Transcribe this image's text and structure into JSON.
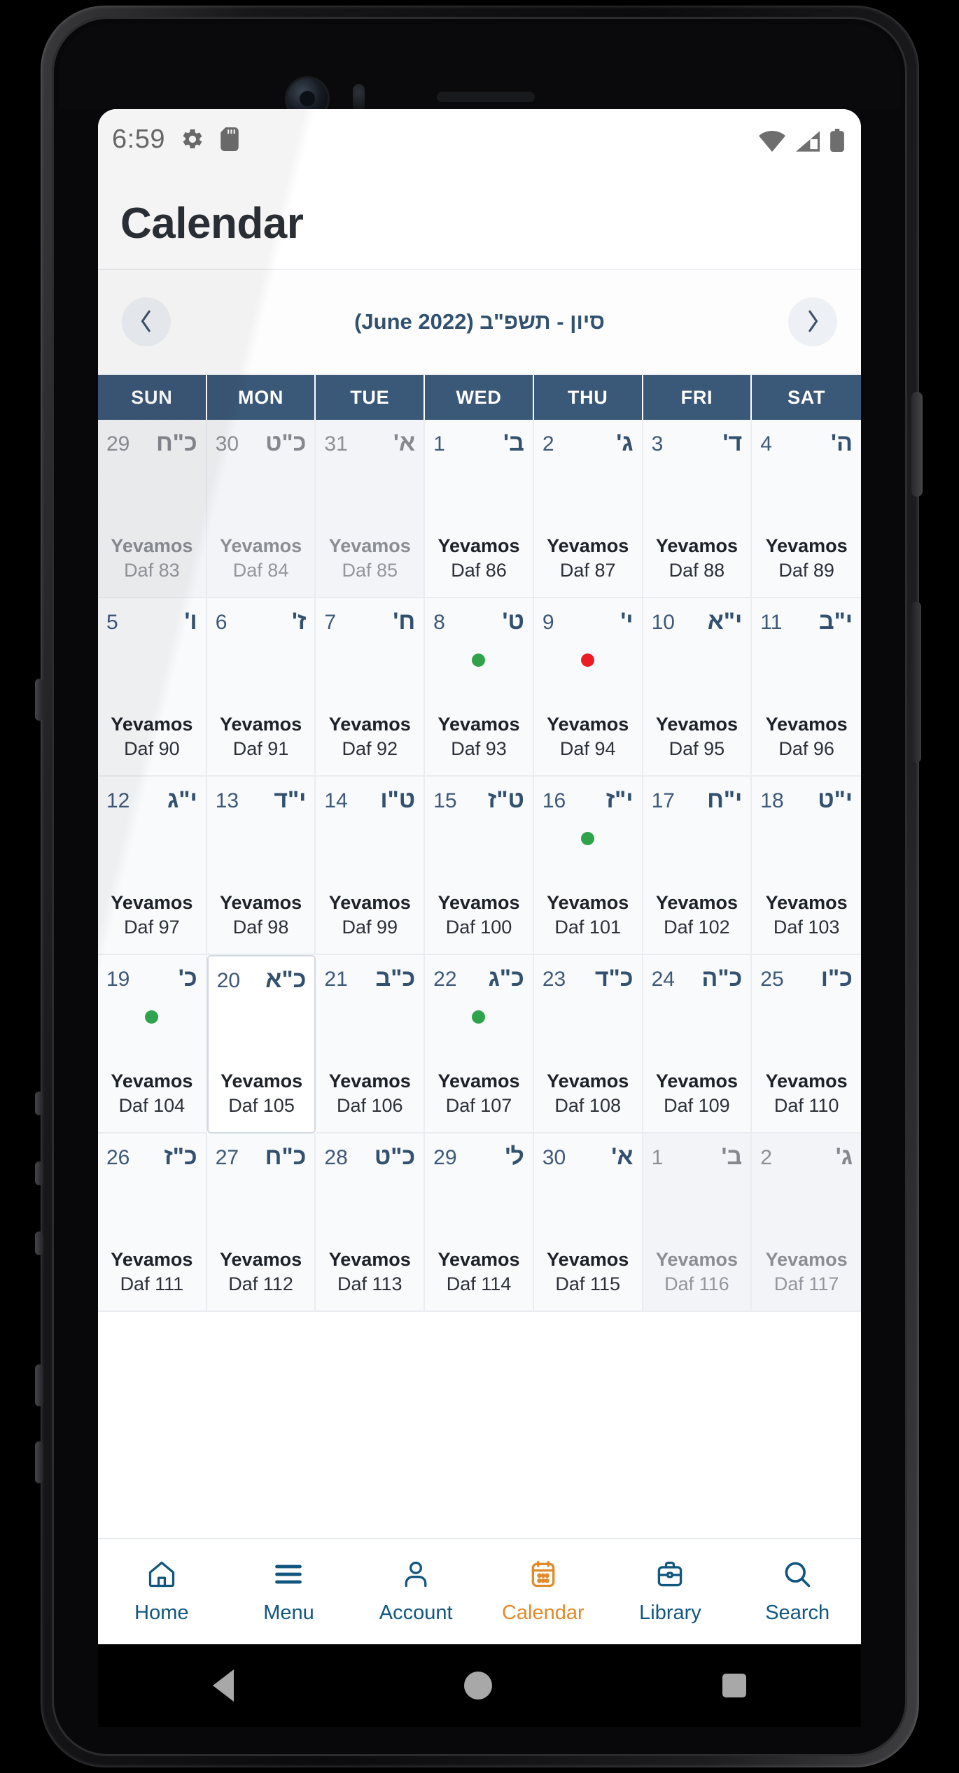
{
  "status_bar": {
    "time": "6:59",
    "left_icons": [
      "gear-icon",
      "sd-card-icon"
    ],
    "right_icons": [
      "wifi-icon",
      "cellular-signal-icon",
      "battery-icon"
    ]
  },
  "header": {
    "title": "Calendar"
  },
  "month_nav": {
    "prev_label": "‹",
    "next_label": "›",
    "month_title": "סיון - תשפ\"ב (June 2022)"
  },
  "weekdays": [
    "SUN",
    "MON",
    "TUE",
    "WED",
    "THU",
    "FRI",
    "SAT"
  ],
  "colors": {
    "header_blue": "#3a5877",
    "accent_orange": "#e08a2a",
    "nav_blue": "#11567f",
    "dot_green": "#2fa34b",
    "dot_red": "#ec1c24"
  },
  "days": [
    {
      "greg": "29",
      "heb": "כ\"ח",
      "title": "Yevamos",
      "sub": "Daf 83",
      "muted": true,
      "dot": null,
      "selected": false
    },
    {
      "greg": "30",
      "heb": "כ\"ט",
      "title": "Yevamos",
      "sub": "Daf 84",
      "muted": true,
      "dot": null,
      "selected": false
    },
    {
      "greg": "31",
      "heb": "א'",
      "title": "Yevamos",
      "sub": "Daf 85",
      "muted": true,
      "dot": null,
      "selected": false
    },
    {
      "greg": "1",
      "heb": "ב'",
      "title": "Yevamos",
      "sub": "Daf 86",
      "muted": false,
      "dot": null,
      "selected": false
    },
    {
      "greg": "2",
      "heb": "ג'",
      "title": "Yevamos",
      "sub": "Daf 87",
      "muted": false,
      "dot": null,
      "selected": false
    },
    {
      "greg": "3",
      "heb": "ד'",
      "title": "Yevamos",
      "sub": "Daf 88",
      "muted": false,
      "dot": null,
      "selected": false
    },
    {
      "greg": "4",
      "heb": "ה'",
      "title": "Yevamos",
      "sub": "Daf 89",
      "muted": false,
      "dot": null,
      "selected": false
    },
    {
      "greg": "5",
      "heb": "ו'",
      "title": "Yevamos",
      "sub": "Daf 90",
      "muted": false,
      "dot": null,
      "selected": false
    },
    {
      "greg": "6",
      "heb": "ז'",
      "title": "Yevamos",
      "sub": "Daf 91",
      "muted": false,
      "dot": null,
      "selected": false
    },
    {
      "greg": "7",
      "heb": "ח'",
      "title": "Yevamos",
      "sub": "Daf 92",
      "muted": false,
      "dot": null,
      "selected": false
    },
    {
      "greg": "8",
      "heb": "ט'",
      "title": "Yevamos",
      "sub": "Daf 93",
      "muted": false,
      "dot": "green",
      "selected": false
    },
    {
      "greg": "9",
      "heb": "י'",
      "title": "Yevamos",
      "sub": "Daf 94",
      "muted": false,
      "dot": "red",
      "selected": false
    },
    {
      "greg": "10",
      "heb": "י\"א",
      "title": "Yevamos",
      "sub": "Daf 95",
      "muted": false,
      "dot": null,
      "selected": false
    },
    {
      "greg": "11",
      "heb": "י\"ב",
      "title": "Yevamos",
      "sub": "Daf 96",
      "muted": false,
      "dot": null,
      "selected": false
    },
    {
      "greg": "12",
      "heb": "י\"ג",
      "title": "Yevamos",
      "sub": "Daf 97",
      "muted": false,
      "dot": null,
      "selected": false
    },
    {
      "greg": "13",
      "heb": "י\"ד",
      "title": "Yevamos",
      "sub": "Daf 98",
      "muted": false,
      "dot": null,
      "selected": false
    },
    {
      "greg": "14",
      "heb": "ט\"ו",
      "title": "Yevamos",
      "sub": "Daf 99",
      "muted": false,
      "dot": null,
      "selected": false
    },
    {
      "greg": "15",
      "heb": "ט\"ז",
      "title": "Yevamos",
      "sub": "Daf 100",
      "muted": false,
      "dot": null,
      "selected": false
    },
    {
      "greg": "16",
      "heb": "י\"ז",
      "title": "Yevamos",
      "sub": "Daf 101",
      "muted": false,
      "dot": "green",
      "selected": false
    },
    {
      "greg": "17",
      "heb": "י\"ח",
      "title": "Yevamos",
      "sub": "Daf 102",
      "muted": false,
      "dot": null,
      "selected": false
    },
    {
      "greg": "18",
      "heb": "י\"ט",
      "title": "Yevamos",
      "sub": "Daf 103",
      "muted": false,
      "dot": null,
      "selected": false
    },
    {
      "greg": "19",
      "heb": "כ'",
      "title": "Yevamos",
      "sub": "Daf 104",
      "muted": false,
      "dot": "green",
      "selected": false
    },
    {
      "greg": "20",
      "heb": "כ\"א",
      "title": "Yevamos",
      "sub": "Daf 105",
      "muted": false,
      "dot": null,
      "selected": true
    },
    {
      "greg": "21",
      "heb": "כ\"ב",
      "title": "Yevamos",
      "sub": "Daf 106",
      "muted": false,
      "dot": null,
      "selected": false
    },
    {
      "greg": "22",
      "heb": "כ\"ג",
      "title": "Yevamos",
      "sub": "Daf 107",
      "muted": false,
      "dot": "green",
      "selected": false
    },
    {
      "greg": "23",
      "heb": "כ\"ד",
      "title": "Yevamos",
      "sub": "Daf 108",
      "muted": false,
      "dot": null,
      "selected": false
    },
    {
      "greg": "24",
      "heb": "כ\"ה",
      "title": "Yevamos",
      "sub": "Daf 109",
      "muted": false,
      "dot": null,
      "selected": false
    },
    {
      "greg": "25",
      "heb": "כ\"ו",
      "title": "Yevamos",
      "sub": "Daf 110",
      "muted": false,
      "dot": null,
      "selected": false
    },
    {
      "greg": "26",
      "heb": "כ\"ז",
      "title": "Yevamos",
      "sub": "Daf 111",
      "muted": false,
      "dot": null,
      "selected": false
    },
    {
      "greg": "27",
      "heb": "כ\"ח",
      "title": "Yevamos",
      "sub": "Daf 112",
      "muted": false,
      "dot": null,
      "selected": false
    },
    {
      "greg": "28",
      "heb": "כ\"ט",
      "title": "Yevamos",
      "sub": "Daf 113",
      "muted": false,
      "dot": null,
      "selected": false
    },
    {
      "greg": "29",
      "heb": "ל'",
      "title": "Yevamos",
      "sub": "Daf 114",
      "muted": false,
      "dot": null,
      "selected": false
    },
    {
      "greg": "30",
      "heb": "א'",
      "title": "Yevamos",
      "sub": "Daf 115",
      "muted": false,
      "dot": null,
      "selected": false
    },
    {
      "greg": "1",
      "heb": "ב'",
      "title": "Yevamos",
      "sub": "Daf 116",
      "muted": true,
      "dot": null,
      "selected": false
    },
    {
      "greg": "2",
      "heb": "ג'",
      "title": "Yevamos",
      "sub": "Daf 117",
      "muted": true,
      "dot": null,
      "selected": false
    }
  ],
  "bottom_nav": [
    {
      "label": "Home",
      "icon": "home-icon",
      "active": false
    },
    {
      "label": "Menu",
      "icon": "hamburger-icon",
      "active": false
    },
    {
      "label": "Account",
      "icon": "person-icon",
      "active": false
    },
    {
      "label": "Calendar",
      "icon": "calendar-icon",
      "active": true
    },
    {
      "label": "Library",
      "icon": "briefcase-icon",
      "active": false
    },
    {
      "label": "Search",
      "icon": "search-icon",
      "active": false
    }
  ],
  "android_nav": {
    "back": "back-triangle-icon",
    "home": "home-circle-icon",
    "recent": "recent-square-icon"
  }
}
